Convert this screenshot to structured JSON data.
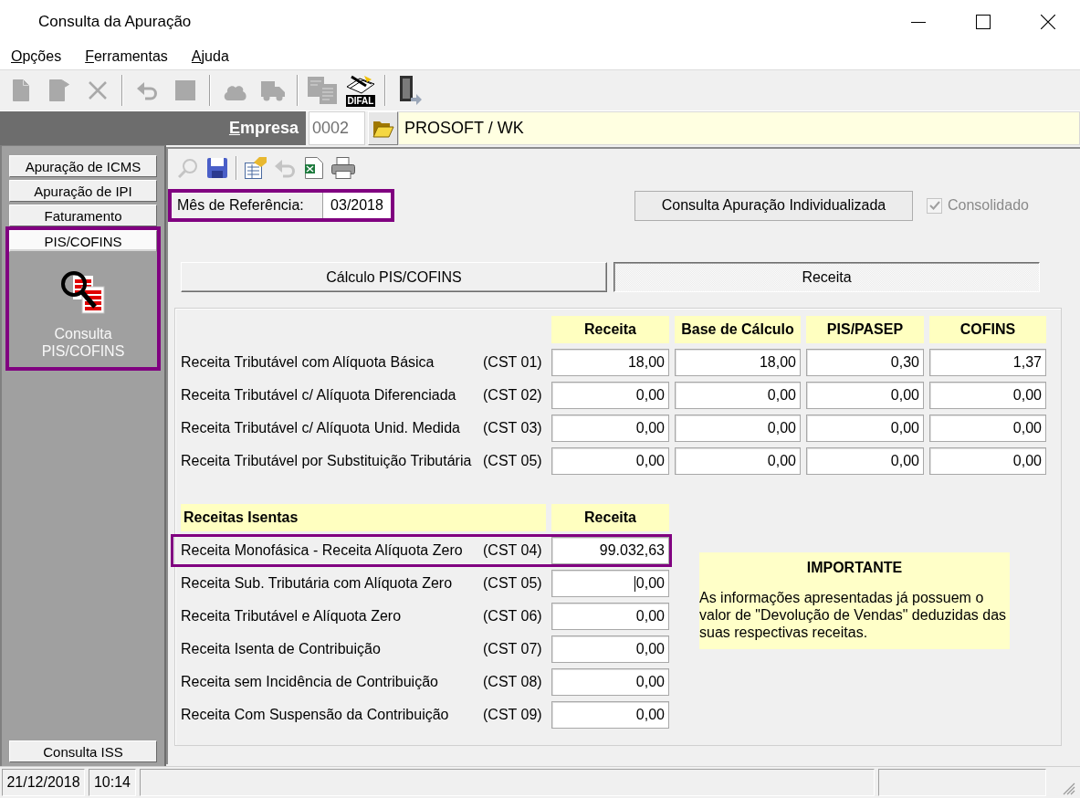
{
  "window": {
    "title": "Consulta da Apuração"
  },
  "menu": [
    {
      "label": "Opções",
      "mnemonic": true
    },
    {
      "label": "Ferramentas",
      "mnemonic": true
    },
    {
      "label": "Ajuda",
      "mnemonic": true
    }
  ],
  "toolbar": [
    {
      "kind": "button",
      "disabled": true
    },
    {
      "kind": "button",
      "disabled": true
    },
    {
      "kind": "button",
      "disabled": true
    },
    {
      "kind": "separator"
    },
    {
      "kind": "button",
      "disabled": true
    },
    {
      "kind": "button",
      "disabled": true
    },
    {
      "kind": "separator"
    },
    {
      "kind": "button",
      "disabled": true
    },
    {
      "kind": "button",
      "disabled": true
    },
    {
      "kind": "separator"
    },
    {
      "kind": "button",
      "disabled": true
    },
    {
      "kind": "captioned",
      "caption": "DIFAL",
      "disabled": false
    },
    {
      "kind": "separator"
    },
    {
      "kind": "button",
      "disabled": false
    }
  ],
  "company": {
    "label": "Empresa",
    "mnemonic": true,
    "code": "0002",
    "name": "PROSOFT / WK"
  },
  "sidebar": {
    "groups": [
      {
        "label": "Apuração de ICMS",
        "selected": false,
        "highlighted": false
      },
      {
        "label": "Apuração de IPI",
        "selected": false,
        "highlighted": false
      },
      {
        "label": "Faturamento",
        "selected": false,
        "highlighted": false
      },
      {
        "label": "PIS/COFINS",
        "selected": true,
        "highlighted": true,
        "items": [
          {
            "label": "Consulta PIS/COFINS"
          }
        ]
      },
      {
        "label": "Consulta ISS",
        "selected": false,
        "highlighted": false
      }
    ]
  },
  "subtoolbar": [
    {
      "kind": "button",
      "disabled": true
    },
    {
      "kind": "button",
      "disabled": false
    },
    {
      "kind": "separator"
    },
    {
      "kind": "button",
      "disabled": false
    },
    {
      "kind": "button",
      "disabled": true
    },
    {
      "kind": "button",
      "disabled": false
    },
    {
      "kind": "button",
      "disabled": false
    }
  ],
  "reference_month": {
    "label": "Mês de Referência:",
    "value": "03/2018",
    "highlighted": true
  },
  "individual_button": {
    "label": "Consulta Apuração Individualizada"
  },
  "consolidated": {
    "label": "Consolidado",
    "checked": true,
    "disabled": true
  },
  "tabs": [
    {
      "label": "Cálculo PIS/COFINS",
      "selected": false
    },
    {
      "label": "Receita",
      "selected": true
    }
  ],
  "taxable": {
    "columns": [
      "Receita",
      "Base de Cálculo",
      "PIS/PASEP",
      "COFINS"
    ],
    "rows": [
      {
        "label": "Receita Tributável com Alíquota Básica",
        "code": "(CST 01)",
        "values": [
          "18,00",
          "18,00",
          "0,30",
          "1,37"
        ]
      },
      {
        "label": "Receita Tributável c/ Alíquota Diferenciada",
        "code": "(CST 02)",
        "values": [
          "0,00",
          "0,00",
          "0,00",
          "0,00"
        ]
      },
      {
        "label": "Receita Tributável c/ Alíquota Unid. Medida",
        "code": "(CST 03)",
        "values": [
          "0,00",
          "0,00",
          "0,00",
          "0,00"
        ]
      },
      {
        "label": "Receita Tributável por Substituição Tributária",
        "code": "(CST 05)",
        "values": [
          "0,00",
          "0,00",
          "0,00",
          "0,00"
        ]
      }
    ]
  },
  "exempt": {
    "columns": [
      "Receitas Isentas",
      "Receita"
    ],
    "rows": [
      {
        "label": "Receita Monofásica - Receita Alíquota Zero",
        "code": "(CST 04)",
        "value": "99.032,63",
        "highlighted": true,
        "focused": false
      },
      {
        "label": "Receita Sub. Tributária com Alíquota Zero",
        "code": "(CST 05)",
        "value": "0,00",
        "highlighted": false,
        "focused": true
      },
      {
        "label": "Receita Tributável e Alíquota Zero",
        "code": "(CST 06)",
        "value": "0,00",
        "highlighted": false,
        "focused": false
      },
      {
        "label": "Receita Isenta de Contribuição",
        "code": "(CST 07)",
        "value": "0,00",
        "highlighted": false,
        "focused": false
      },
      {
        "label": "Receita sem Incidência de Contribuição",
        "code": "(CST 08)",
        "value": "0,00",
        "highlighted": false,
        "focused": false
      },
      {
        "label": "Receita Com Suspensão da Contribuição",
        "code": "(CST 09)",
        "value": "0,00",
        "highlighted": false,
        "focused": false
      }
    ]
  },
  "notice": {
    "title": "IMPORTANTE",
    "text": "As informações apresentadas já possuem o valor de \"Devolução de Vendas\" deduzidas das suas respectivas receitas."
  },
  "status_bar": {
    "date": "21/12/2018",
    "time": "10:14"
  }
}
